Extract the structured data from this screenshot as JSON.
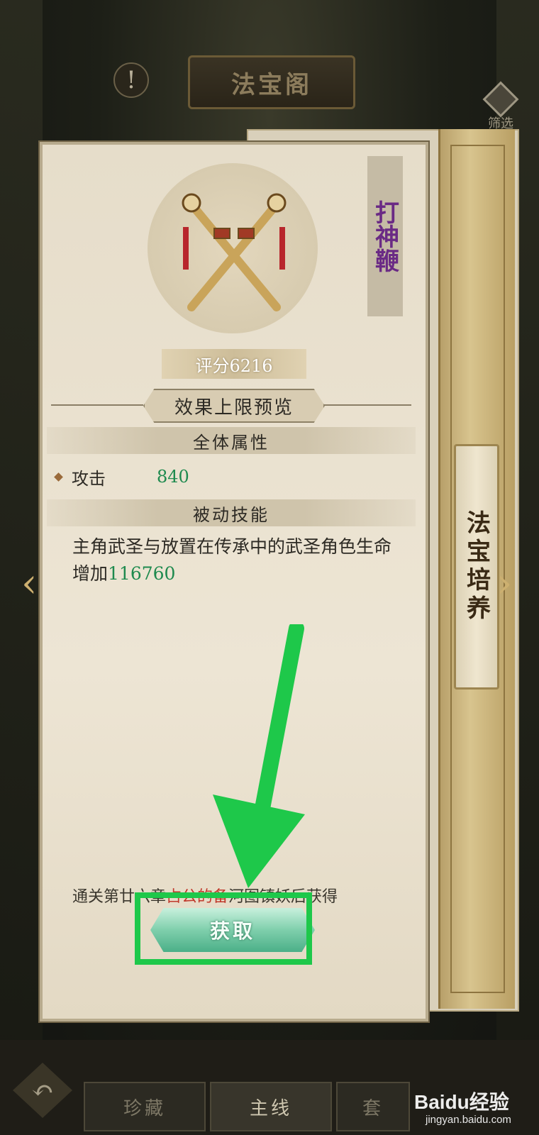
{
  "header": {
    "title": "法宝阁",
    "filter_label": "筛选"
  },
  "item": {
    "name": "打神鞭",
    "score": "评分6216"
  },
  "preview": {
    "title": "效果上限预览",
    "attributes_header": "全体属性",
    "stats": [
      {
        "name": "攻击",
        "value": "840"
      }
    ],
    "passive_header": "被动技能",
    "passive_text": "主角武圣与放置在传承中的武圣角色生命增加",
    "passive_value": "116760"
  },
  "acquire": {
    "source_prefix": "通关第廿六章",
    "source_highlight": "占公的备",
    "source_suffix": "河图镇妖后获得",
    "button_label": "获取"
  },
  "side_tab": {
    "label": "法宝培养"
  },
  "bottom_nav": {
    "tabs": [
      {
        "label": "珍藏"
      },
      {
        "label": "主线"
      },
      {
        "label": "套"
      }
    ]
  },
  "watermark": {
    "brand": "Baidu经验",
    "url": "jingyan.baidu.com"
  },
  "colors": {
    "stat_value": "#1e8a4e",
    "highlight_box": "#1ec84a",
    "item_name": "#6a2a85"
  }
}
